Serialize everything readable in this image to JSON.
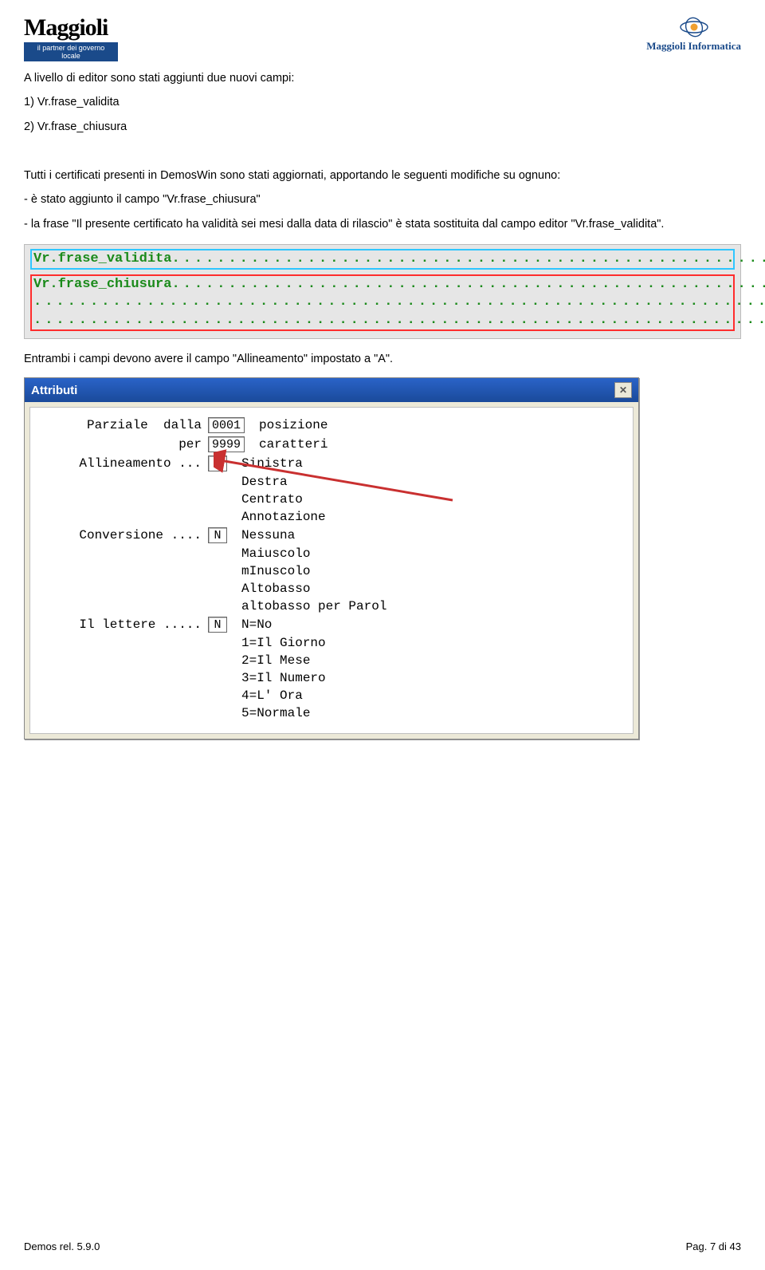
{
  "header": {
    "logo_main": "Maggioli",
    "logo_sub": "il partner dei governo locale",
    "logo_right": "Maggioli Informatica"
  },
  "intro": {
    "line": "A livello di editor sono stati aggiunti due nuovi campi:",
    "item1": "1)  Vr.frase_validita",
    "item2": "2)  Vr.frase_chiusura"
  },
  "para2": {
    "l1": "Tutti i certificati presenti in DemosWin sono stati aggiornati, apportando le seguenti modifiche su ognuno:",
    "l2": "- è stato aggiunto il campo \"Vr.frase_chiusura\"",
    "l3": "- la frase \"Il presente certificato ha validità sei mesi dalla data di rilascio\" è stata sostituita dal campo editor \"Vr.frase_validita\"."
  },
  "fieldbox": {
    "f1": "Vr.frase_validita",
    "dots1": "............................................................",
    "f2": "Vr.frase_chiusura",
    "dots2": "............................................................",
    "dots3": ".............................................................................",
    "dots4": "............................................................................."
  },
  "mid_text": "Entrambi i campi devono avere il campo \"Allineamento\" impostato a \"A\".",
  "dialog": {
    "title": "Attributi",
    "rows": {
      "parziale_lbl": "Parziale  dalla",
      "parziale_val": "0001",
      "parziale_sfx": "posizione",
      "per_lbl": "per",
      "per_val": "9999",
      "per_sfx": "caratteri",
      "allin_lbl": "Allineamento ...",
      "allin_val": "A",
      "allin_sfx": "Sinistra",
      "opt_destra": "Destra",
      "opt_centrato": "Centrato",
      "opt_annot": "Annotazione",
      "conv_lbl": "Conversione ....",
      "conv_val": "N",
      "conv_sfx": "Nessuna",
      "opt_mai": "Maiuscolo",
      "opt_min": "mInuscolo",
      "opt_alto": "Altobasso",
      "opt_altop": "altobasso per Parol",
      "lett_lbl": "Il lettere .....",
      "lett_val": "N",
      "lett_sfx": "N=No",
      "opt_1": "1=Il Giorno",
      "opt_2": "2=Il Mese",
      "opt_3": "3=Il Numero",
      "opt_4": "4=L' Ora",
      "opt_5": "5=Normale"
    }
  },
  "footer": {
    "left": "Demos rel. 5.9.0",
    "right": "Pag. 7 di 43"
  }
}
